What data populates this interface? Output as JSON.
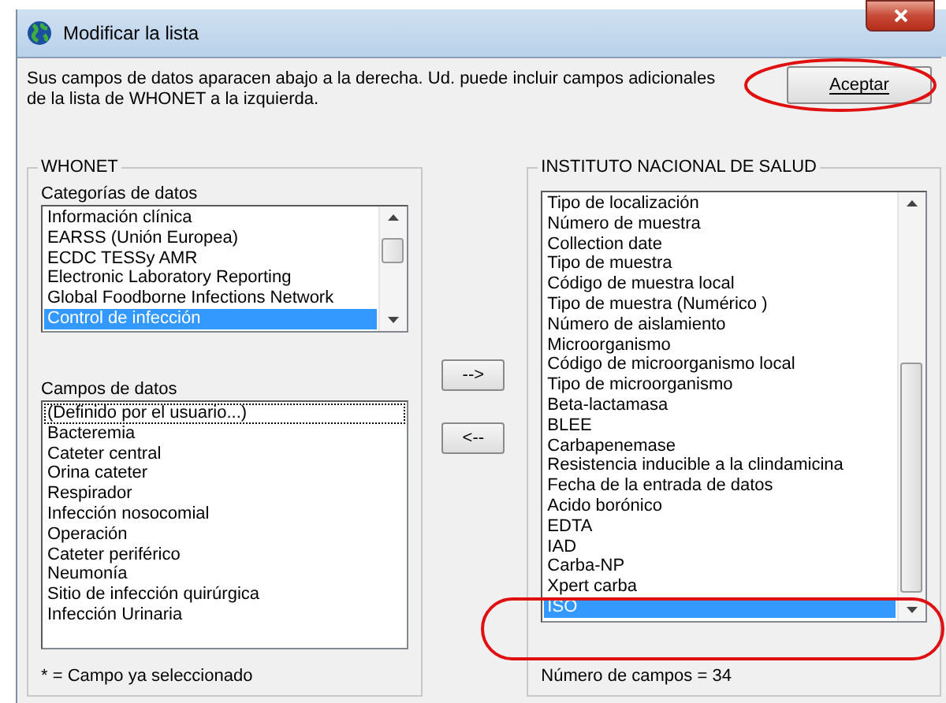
{
  "window": {
    "title": "Modificar la lista"
  },
  "instructions": "Sus campos de datos aparacen abajo a la derecha.  Ud. puede incluir campos adicionales de la lista de WHONET a la izquierda.",
  "ok_button": "Aceptar",
  "left_group": {
    "title": "WHONET",
    "categories_label": "Categorías de datos",
    "categories": [
      {
        "label": "Información clínica",
        "selected": false
      },
      {
        "label": "EARSS (Unión Europea)",
        "selected": false
      },
      {
        "label": "ECDC TESSy AMR",
        "selected": false
      },
      {
        "label": "Electronic Laboratory Reporting",
        "selected": false
      },
      {
        "label": "Global Foodborne Infections Network",
        "selected": false
      },
      {
        "label": "Control de infección",
        "selected": true
      }
    ],
    "fields_label": "Campos de datos",
    "fields": [
      {
        "label": "(Definido por el usuario...)",
        "selected": false,
        "focused": true
      },
      {
        "label": "Bacteremia",
        "selected": false,
        "focused": false
      },
      {
        "label": "Cateter central",
        "selected": false,
        "focused": false
      },
      {
        "label": "Orina cateter",
        "selected": false,
        "focused": false
      },
      {
        "label": "Respirador",
        "selected": false,
        "focused": false
      },
      {
        "label": "Infección nosocomial",
        "selected": false,
        "focused": false
      },
      {
        "label": "Operación",
        "selected": false,
        "focused": false
      },
      {
        "label": "Cateter periférico",
        "selected": false,
        "focused": false
      },
      {
        "label": "Neumonía",
        "selected": false,
        "focused": false
      },
      {
        "label": "Sitio de infección quirúrgica",
        "selected": false,
        "focused": false
      },
      {
        "label": "Infección Urinaria",
        "selected": false,
        "focused": false
      }
    ],
    "legend": "* = Campo ya seleccionado"
  },
  "move_buttons": [
    "-->",
    "<--"
  ],
  "right_group": {
    "title": "INSTITUTO NACIONAL DE SALUD",
    "fields": [
      {
        "label": "Tipo de localización",
        "selected": false
      },
      {
        "label": "Número de muestra",
        "selected": false
      },
      {
        "label": "Collection date",
        "selected": false
      },
      {
        "label": "Tipo de muestra",
        "selected": false
      },
      {
        "label": "Código de muestra local",
        "selected": false
      },
      {
        "label": "Tipo de muestra (Numérico )",
        "selected": false
      },
      {
        "label": "Número de aislamiento",
        "selected": false
      },
      {
        "label": "Microorganismo",
        "selected": false
      },
      {
        "label": "Código de microorganismo local",
        "selected": false
      },
      {
        "label": "Tipo de microorganismo",
        "selected": false
      },
      {
        "label": "Beta-lactamasa",
        "selected": false
      },
      {
        "label": "BLEE",
        "selected": false
      },
      {
        "label": "Carbapenemase",
        "selected": false
      },
      {
        "label": "Resistencia inducible a la clindamicina",
        "selected": false
      },
      {
        "label": "Fecha de la entrada de datos",
        "selected": false
      },
      {
        "label": "Acido borónico",
        "selected": false
      },
      {
        "label": "EDTA",
        "selected": false
      },
      {
        "label": "IAD",
        "selected": false
      },
      {
        "label": "Carba-NP",
        "selected": false
      },
      {
        "label": "Xpert carba",
        "selected": false
      },
      {
        "label": "ISO",
        "selected": true
      }
    ],
    "count": "Número de campos = 34"
  }
}
